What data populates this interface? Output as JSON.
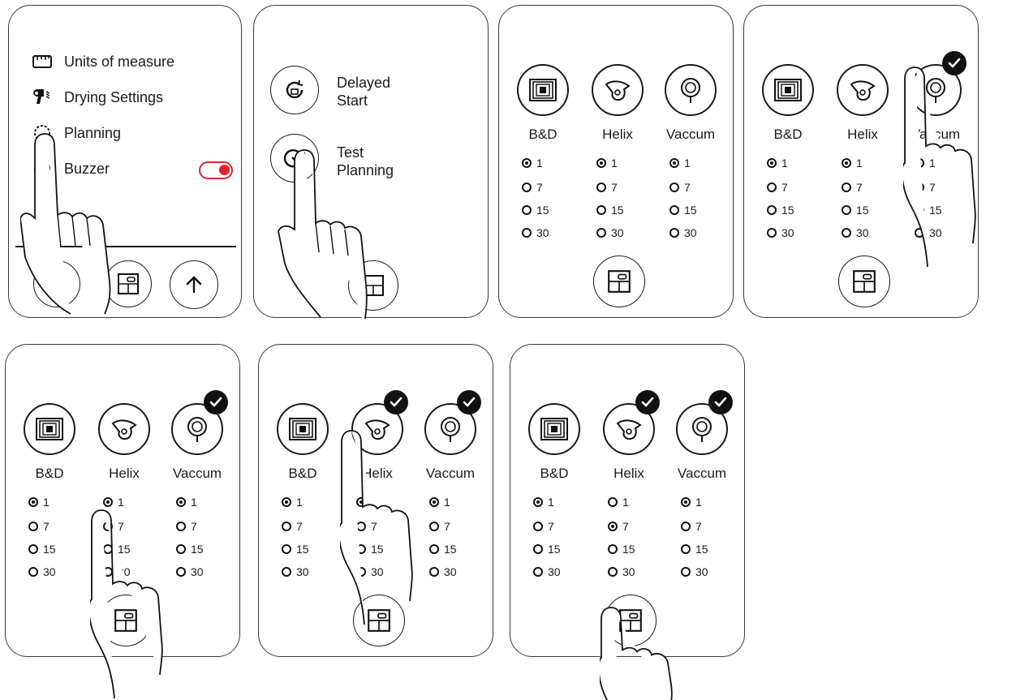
{
  "panel1": {
    "menu": [
      {
        "label": "Units of measure",
        "icon": "ruler-icon"
      },
      {
        "label": "Drying Settings",
        "icon": "hair-dryer-icon"
      },
      {
        "label": "Planning",
        "icon": "planning-icon"
      },
      {
        "label": "Buzzer",
        "icon": "buzzer-icon"
      }
    ],
    "buzzer_toggle_on": true,
    "toggle_color": "#e0232f",
    "bottom_buttons": [
      "chamber-icon",
      "arrow-up-icon"
    ]
  },
  "panel2": {
    "options": [
      {
        "label_line1": "Delayed",
        "label_line2": "Start",
        "icon": "delayed-start-icon"
      },
      {
        "label_line1": "Test",
        "label_line2": "Planning",
        "icon": "test-planning-icon"
      }
    ]
  },
  "tests": [
    "B&D",
    "Helix",
    "Vaccum"
  ],
  "frequencies": [
    "1",
    "7",
    "15",
    "30"
  ],
  "states": [
    {
      "checked": [
        false,
        false,
        false
      ],
      "selected": [
        "1",
        "1",
        "1"
      ]
    },
    {
      "checked": [
        false,
        false,
        true
      ],
      "selected": [
        "1",
        "1",
        "1"
      ]
    },
    {
      "checked": [
        false,
        false,
        true
      ],
      "selected": [
        "1",
        "1",
        "1"
      ]
    },
    {
      "checked": [
        false,
        true,
        true
      ],
      "selected": [
        "1",
        "1",
        "1"
      ]
    },
    {
      "checked": [
        false,
        true,
        true
      ],
      "selected": [
        "1",
        "7",
        "1"
      ]
    }
  ]
}
